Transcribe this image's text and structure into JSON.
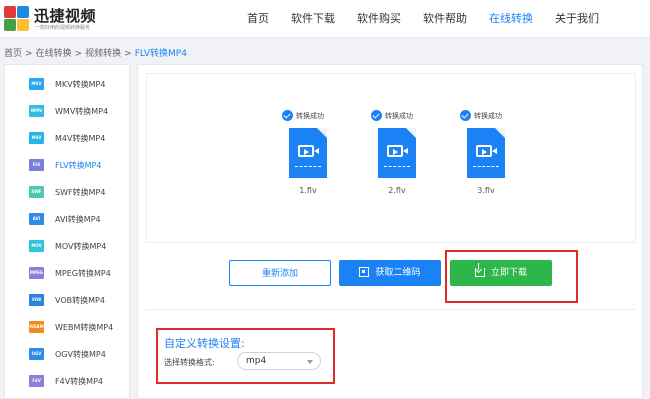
{
  "header": {
    "logo_name": "迅捷视频",
    "logo_slogan": "一款好用的视频转换服务",
    "nav": [
      "首页",
      "软件下载",
      "软件购买",
      "软件帮助",
      "在线转换",
      "关于我们"
    ],
    "active_nav": "在线转换"
  },
  "breadcrumb": [
    "首页",
    "在线转换",
    "视频转换",
    "FLV转换MP4"
  ],
  "sidebar": {
    "items": [
      {
        "icon": "MKV",
        "label": "MKV转换MP4",
        "color": "#2aa8ef"
      },
      {
        "icon": "WMV",
        "label": "WMV转换MP4",
        "color": "#35bde0"
      },
      {
        "icon": "M4V",
        "label": "M4V转换MP4",
        "color": "#27b5e8"
      },
      {
        "icon": "FLV",
        "label": "FLV转换MP4",
        "color": "#7a7fd6"
      },
      {
        "icon": "SWF",
        "label": "SWF转换MP4",
        "color": "#4ac9b6"
      },
      {
        "icon": "AVI",
        "label": "AVI转换MP4",
        "color": "#2f8de8"
      },
      {
        "icon": "MOV",
        "label": "MOV转换MP4",
        "color": "#33c2d8"
      },
      {
        "icon": "MPEG",
        "label": "MPEG转换MP4",
        "color": "#8b7fd9"
      },
      {
        "icon": "VOB",
        "label": "VOB转换MP4",
        "color": "#2a84e0"
      },
      {
        "icon": "WEBM",
        "label": "WEBM转换MP4",
        "color": "#f08a1c"
      },
      {
        "icon": "OGV",
        "label": "OGV转换MP4",
        "color": "#2f8de8"
      },
      {
        "icon": "F4V",
        "label": "F4V转换MP4",
        "color": "#8b7fd9"
      }
    ],
    "active_label": "FLV转换MP4"
  },
  "files": [
    {
      "status": "转换成功",
      "name": "1.flv"
    },
    {
      "status": "转换成功",
      "name": "2.flv"
    },
    {
      "status": "转换成功",
      "name": "3.flv"
    }
  ],
  "buttons": {
    "readd": "重新添加",
    "qr": "获取二维码",
    "download": "立即下载"
  },
  "settings": {
    "title": "自定义转换设置:",
    "format_label": "选择转换格式:",
    "format_value": "mp4"
  },
  "colors": {
    "accent": "#1b82f5",
    "download": "#2db74a",
    "highlight": "#e02b2b"
  }
}
